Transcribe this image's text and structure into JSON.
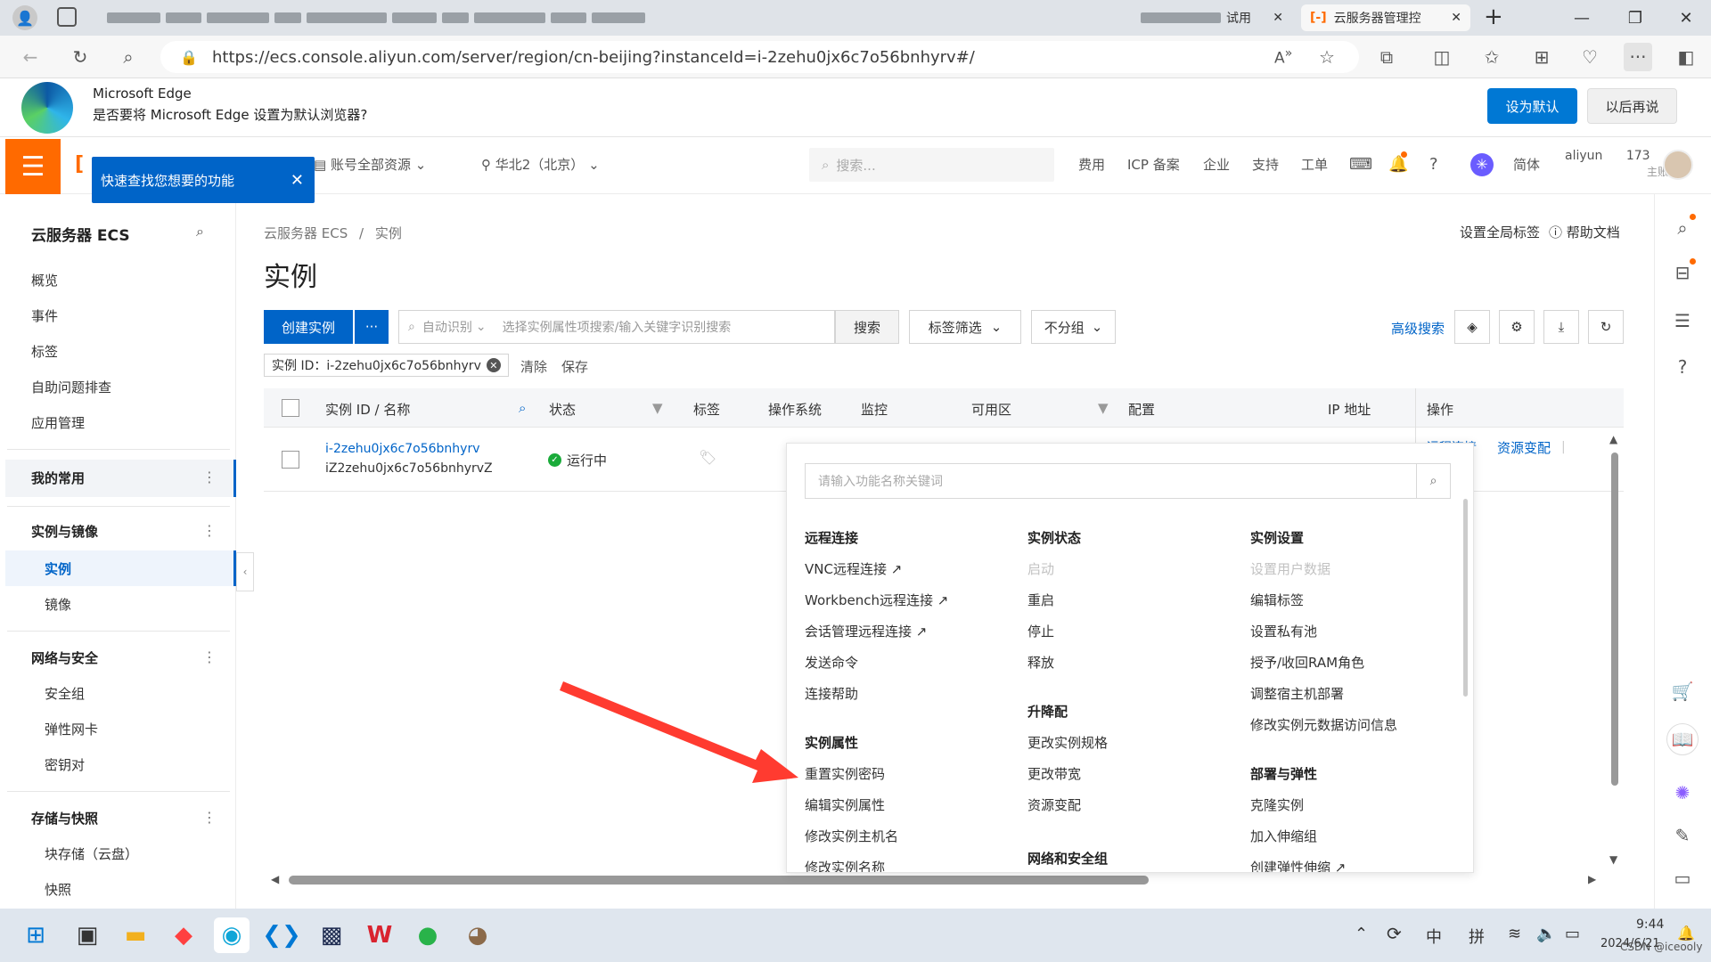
{
  "browser": {
    "tabs": [
      {
        "label": "云服务器管理控",
        "active": true
      }
    ],
    "partial_tab_label": "试用",
    "new_tab": "+",
    "url": "https://ecs.console.aliyun.com/server/region/cn-beijing?instanceId=i-2zehu0jx6c7o56bnhyrv#/"
  },
  "banner": {
    "title": "Microsoft Edge",
    "message": "是否要将 Microsoft Edge 设置为默认浏览器?",
    "set_default": "设为默认",
    "later": "以后再说"
  },
  "console_header": {
    "tooltip": "快速查找您想要的功能",
    "resource_group": "账号全部资源",
    "region": "华北2（北京）",
    "search_placeholder": "搜索...",
    "links": [
      "费用",
      "ICP 备案",
      "企业",
      "支持",
      "工单"
    ],
    "lang": "简体",
    "account": "aliyun",
    "account_suffix": "173",
    "account_role": "主账号"
  },
  "sidebar": {
    "title": "云服务器 ECS",
    "top_items": [
      "概览",
      "事件",
      "标签",
      "自助问题排查",
      "应用管理"
    ],
    "favorites": "我的常用",
    "groups": [
      {
        "title": "实例与镜像",
        "items": [
          "实例",
          "镜像"
        ]
      },
      {
        "title": "网络与安全",
        "items": [
          "安全组",
          "弹性网卡",
          "密钥对"
        ]
      },
      {
        "title": "存储与快照",
        "items": [
          "块存储（云盘）",
          "快照"
        ]
      }
    ]
  },
  "main": {
    "breadcrumb": [
      "云服务器 ECS",
      "实例"
    ],
    "breadcrumb_sep": "/",
    "page_title": "实例",
    "global_tags": "设置全局标签",
    "help_docs": "帮助文档",
    "create_button": "创建实例",
    "more_button": "···",
    "auto_detect": "自动识别",
    "search_placeholder": "选择实例属性项搜索/输入关键字识别搜索",
    "search_button": "搜索",
    "tag_filter": "标签筛选",
    "no_group": "不分组",
    "advanced_search": "高级搜索",
    "filter_chip": "实例 ID：i-2zehu0jx6c7o56bnhyrv",
    "clear": "清除",
    "save": "保存",
    "columns": [
      "实例 ID / 名称",
      "状态",
      "标签",
      "操作系统",
      "监控",
      "可用区",
      "配置",
      "IP 地址",
      "操作"
    ],
    "row": {
      "id": "i-2zehu0jx6c7o56bnhyrv",
      "name": "iZ2zehu0jx6c7o56bnhyrvZ",
      "status": "运行中",
      "action_partial": "远程连接",
      "action_resource": "资源变配"
    }
  },
  "dropdown": {
    "search_placeholder": "请输入功能名称关键词",
    "col1": {
      "sections": [
        {
          "title": "远程连接",
          "items": [
            "VNC远程连接",
            "Workbench远程连接",
            "会话管理远程连接",
            "发送命令",
            "连接帮助"
          ]
        },
        {
          "title": "实例属性",
          "items": [
            "重置实例密码",
            "编辑实例属性",
            "修改实例主机名",
            "修改实例名称"
          ]
        }
      ]
    },
    "col2": {
      "sections": [
        {
          "title": "实例状态",
          "items": [
            "启动",
            "重启",
            "停止",
            "释放"
          ]
        },
        {
          "title": "升降配",
          "items": [
            "更改实例规格",
            "更改带宽",
            "资源变配"
          ]
        },
        {
          "title": "网络和安全组",
          "items": []
        }
      ]
    },
    "col3": {
      "sections": [
        {
          "title": "实例设置",
          "items": [
            "设置用户数据",
            "编辑标签",
            "设置私有池",
            "授予/收回RAM角色",
            "调整宿主机部署",
            "修改实例元数据访问信息"
          ]
        },
        {
          "title": "部署与弹性",
          "items": [
            "克隆实例",
            "加入伸缩组",
            "创建弹性伸缩"
          ]
        }
      ]
    }
  },
  "taskbar": {
    "ime1": "中",
    "ime2": "拼",
    "time": "9:44",
    "date": "2024/6/21",
    "watermark": "CSDN @iceooly"
  },
  "colors": {
    "primary": "#0064c8",
    "aliyun_orange": "#ff6a00",
    "edge_blue": "#0078d4",
    "arrow_red": "#ff3b30",
    "running_green": "#1aab3a"
  }
}
